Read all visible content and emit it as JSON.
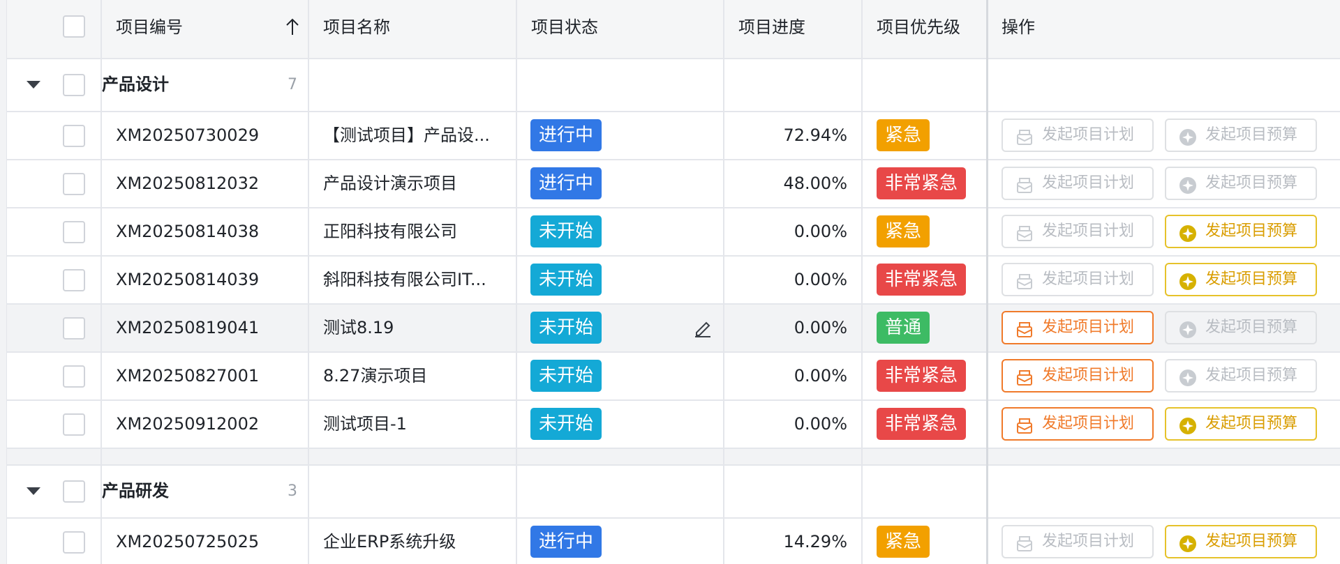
{
  "columns": {
    "code": "项目编号",
    "sort_icon": "arrow-up-icon",
    "name": "项目名称",
    "status": "项目状态",
    "progress": "项目进度",
    "priority": "项目优先级",
    "actions": "操作"
  },
  "colors": {
    "in_progress": "#3178e6",
    "not_started": "#14a9d6",
    "urgent": "#f2a000",
    "very_urgent": "#e84848",
    "normal": "#3dbb64",
    "plan_button": "#f07a2a",
    "budget_button": "#e6c22a",
    "disabled": "#b8bcc2"
  },
  "action_labels": {
    "plan": "发起项目计划",
    "budget": "发起项目预算"
  },
  "groups": [
    {
      "name": "产品设计",
      "count": "7",
      "rows": [
        {
          "code": "XM20250730029",
          "name": "【测试项目】产品设...",
          "status": "进行中",
          "progress": "72.94%",
          "priority": "紧急"
        },
        {
          "code": "XM20250812032",
          "name": "产品设计演示项目",
          "status": "进行中",
          "progress": "48.00%",
          "priority": "非常紧急"
        },
        {
          "code": "XM20250814038",
          "name": "正阳科技有限公司",
          "status": "未开始",
          "progress": "0.00%",
          "priority": "紧急"
        },
        {
          "code": "XM20250814039",
          "name": "斜阳科技有限公司IT...",
          "status": "未开始",
          "progress": "0.00%",
          "priority": "非常紧急"
        },
        {
          "code": "XM20250819041",
          "name": "测试8.19",
          "status": "未开始",
          "progress": "0.00%",
          "priority": "普通"
        },
        {
          "code": "XM20250827001",
          "name": "8.27演示项目",
          "status": "未开始",
          "progress": "0.00%",
          "priority": "非常紧急"
        },
        {
          "code": "XM20250912002",
          "name": "测试项目-1",
          "status": "未开始",
          "progress": "0.00%",
          "priority": "非常紧急"
        }
      ]
    },
    {
      "name": "产品研发",
      "count": "3",
      "rows": [
        {
          "code": "XM20250725025",
          "name": "企业ERP系统升级",
          "status": "进行中",
          "progress": "14.29%",
          "priority": "紧急"
        }
      ]
    }
  ]
}
